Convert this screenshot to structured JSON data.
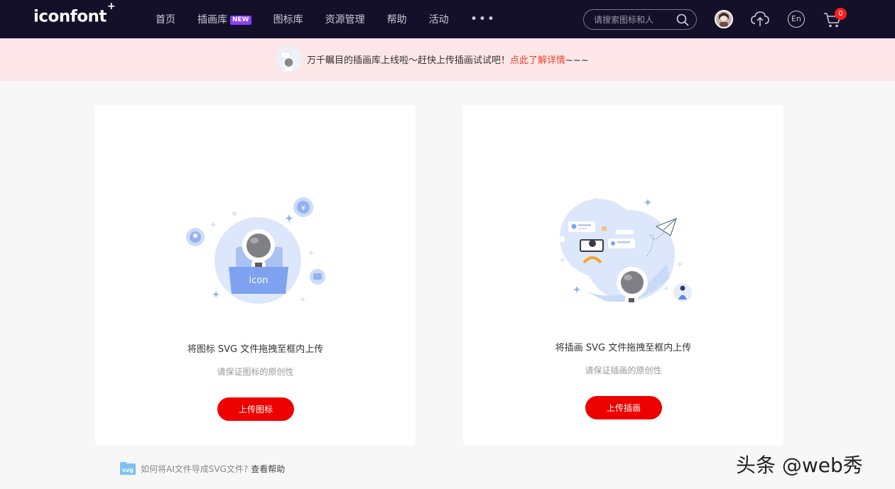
{
  "header": {
    "logo": "iconfont",
    "logo_mark": "+",
    "nav": [
      {
        "label": "首页"
      },
      {
        "label": "插画库",
        "badge": "NEW"
      },
      {
        "label": "图标库"
      },
      {
        "label": "资源管理"
      },
      {
        "label": "帮助"
      },
      {
        "label": "活动"
      }
    ],
    "more": "•••",
    "search_placeholder": "请搜索图标和人",
    "language_label": "En",
    "cart_count": "0"
  },
  "banner": {
    "text": "万千瞩目的插画库上线啦～赶快上传插画试试吧！",
    "link": "点此了解详情",
    "suffix": "~~~"
  },
  "cards": [
    {
      "illustration_label": "icon",
      "title": "将图标 SVG 文件拖拽至框内上传",
      "subtitle": "请保证图标的原创性",
      "button": "上传图标"
    },
    {
      "title": "将插画 SVG 文件拖拽至框内上传",
      "subtitle": "请保证插画的原创性",
      "button": "上传插画"
    }
  ],
  "help": {
    "folder_label": "svg",
    "question": "如何将AI文件导成SVG文件?",
    "link": "查看帮助"
  },
  "watermark": "头条 @web秀",
  "colors": {
    "header_bg": "#14102a",
    "banner_bg": "#fde6e7",
    "accent_red": "#ee0000",
    "link_red": "#f2412d",
    "illustration_blue": "#dce7fb"
  }
}
